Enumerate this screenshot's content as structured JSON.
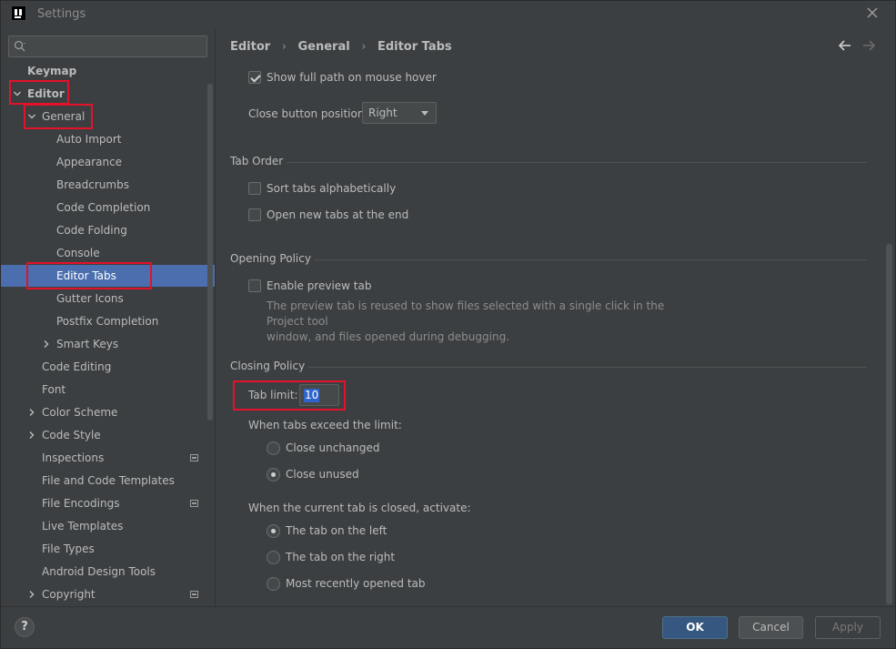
{
  "window": {
    "title": "Settings"
  },
  "search": {
    "placeholder": ""
  },
  "sidebar": {
    "items": [
      {
        "label": "Keymap"
      },
      {
        "label": "Editor"
      },
      {
        "label": "General"
      },
      {
        "label": "Auto Import"
      },
      {
        "label": "Appearance"
      },
      {
        "label": "Breadcrumbs"
      },
      {
        "label": "Code Completion"
      },
      {
        "label": "Code Folding"
      },
      {
        "label": "Console"
      },
      {
        "label": "Editor Tabs"
      },
      {
        "label": "Gutter Icons"
      },
      {
        "label": "Postfix Completion"
      },
      {
        "label": "Smart Keys"
      },
      {
        "label": "Code Editing"
      },
      {
        "label": "Font"
      },
      {
        "label": "Color Scheme"
      },
      {
        "label": "Code Style"
      },
      {
        "label": "Inspections"
      },
      {
        "label": "File and Code Templates"
      },
      {
        "label": "File Encodings"
      },
      {
        "label": "Live Templates"
      },
      {
        "label": "File Types"
      },
      {
        "label": "Android Design Tools"
      },
      {
        "label": "Copyright"
      }
    ]
  },
  "breadcrumb": {
    "items": [
      "Editor",
      "General",
      "Editor Tabs"
    ],
    "separator": "›"
  },
  "settings": {
    "show_full_path": {
      "label": "Show full path on mouse hover",
      "checked": true
    },
    "close_button_position": {
      "label": "Close button position:",
      "value": "Right"
    },
    "tab_order": {
      "title": "Tab Order",
      "sort_alphabetically": {
        "label": "Sort tabs alphabetically",
        "checked": false
      },
      "open_at_end": {
        "label": "Open new tabs at the end",
        "checked": false
      }
    },
    "opening_policy": {
      "title": "Opening Policy",
      "enable_preview": {
        "label": "Enable preview tab",
        "checked": false
      },
      "description_line1": "The preview tab is reused to show files selected with a single click in the Project tool",
      "description_line2": "window, and files opened during debugging."
    },
    "closing_policy": {
      "title": "Closing Policy",
      "tab_limit_label": "Tab limit:",
      "tab_limit_value": "10",
      "exceed_label": "When tabs exceed the limit:",
      "close_unchanged": {
        "label": "Close unchanged",
        "checked": false
      },
      "close_unused": {
        "label": "Close unused",
        "checked": true
      },
      "activate_label": "When the current tab is closed, activate:",
      "tab_left": {
        "label": "The tab on the left",
        "checked": true
      },
      "tab_right": {
        "label": "The tab on the right",
        "checked": false
      },
      "most_recent": {
        "label": "Most recently opened tab",
        "checked": false
      }
    }
  },
  "footer": {
    "help": "?",
    "ok": "OK",
    "cancel": "Cancel",
    "apply": "Apply"
  },
  "colors": {
    "selection": "#4b6eaf",
    "highlight_box": "#e3122a",
    "ok_button": "#365880"
  }
}
